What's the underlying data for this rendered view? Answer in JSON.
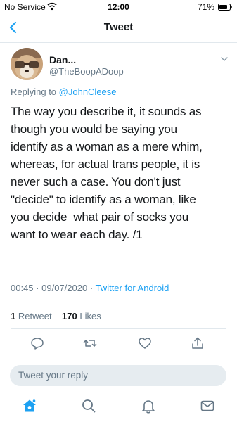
{
  "status_bar": {
    "carrier": "No Service",
    "time": "12:00",
    "battery": "71%"
  },
  "nav": {
    "title": "Tweet",
    "back_icon": "chevron-left-icon"
  },
  "tweet": {
    "author_name": "Dan...",
    "author_handle": "@TheBoopADoop",
    "replying_prefix": "Replying to ",
    "replying_handle": "@JohnCleese",
    "text": "The way you describe it, it sounds as\nthough you would be saying you\nidentify as a woman as a mere whim,\nwhereas, for actual trans people, it is\nnever such a case. You don't just\n\"decide\" to identify as a woman, like\nyou decide  what pair of socks you\nwant to wear each day. /1",
    "time": "00:45",
    "date": "09/07/2020",
    "separator": "·",
    "source": "Twitter for Android",
    "retweets": "1",
    "retweets_label": "Retweet",
    "likes": "170",
    "likes_label": "Likes"
  },
  "reply": {
    "placeholder": "Tweet your reply"
  },
  "colors": {
    "accent": "#1da1f2",
    "secondary_text": "#657786",
    "divider": "#e1e8ed"
  }
}
